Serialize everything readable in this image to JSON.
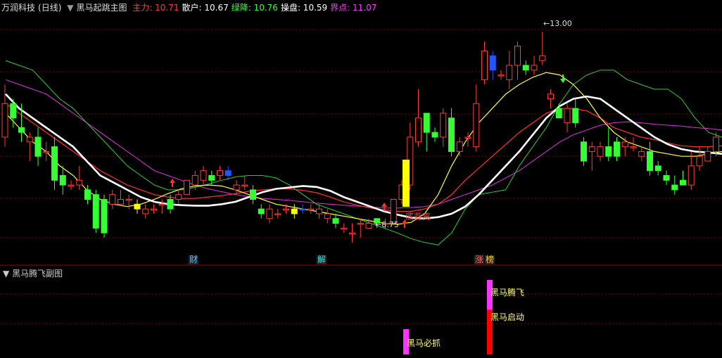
{
  "header": {
    "stock_name": "万润科技",
    "period": "(日线)",
    "indicator_name": "黑马起跳主图",
    "items": [
      {
        "label": "主力:",
        "value": "10.71",
        "color": "#ff3b3b"
      },
      {
        "label": "散户:",
        "value": "10.67",
        "color": "#ffffff"
      },
      {
        "label": "绿降:",
        "value": "10.76",
        "color": "#33ff33"
      },
      {
        "label": "操盘:",
        "value": "10.59",
        "color": "#ffffff"
      },
      {
        "label": "界点:",
        "value": "11.07",
        "color": "#ff33ff"
      }
    ]
  },
  "sub_panel": {
    "title": "黑马腾飞副图"
  },
  "markers": {
    "events": [
      "财",
      "解",
      "涨",
      "榜"
    ]
  },
  "chart_data": {
    "type": "candlestick",
    "price_range": [
      8.2,
      13.4
    ],
    "annotations": {
      "high_label": "13.00",
      "low_label": "8.75",
      "signal_text": "底背离"
    },
    "candles": [
      [
        10.8,
        11.5,
        11.9,
        10.6
      ],
      [
        11.5,
        11.2,
        11.6,
        11.0
      ],
      [
        11.0,
        10.9,
        11.5,
        10.7
      ],
      [
        10.7,
        10.8,
        10.9,
        10.3
      ],
      [
        10.8,
        10.4,
        11.0,
        10.2
      ],
      [
        10.5,
        10.5,
        10.7,
        10.3
      ],
      [
        10.6,
        9.9,
        10.8,
        9.7
      ],
      [
        10.0,
        9.8,
        10.2,
        9.6
      ],
      [
        9.8,
        9.8,
        9.9,
        9.7
      ],
      [
        9.8,
        9.9,
        10.2,
        9.7
      ],
      [
        9.7,
        9.5,
        9.8,
        9.4
      ],
      [
        9.6,
        8.9,
        9.7,
        8.8
      ],
      [
        9.5,
        8.8,
        9.6,
        8.7
      ],
      [
        9.4,
        9.6,
        9.7,
        9.3
      ],
      [
        9.4,
        9.5,
        9.7,
        9.4
      ],
      [
        9.5,
        9.5,
        9.6,
        9.3
      ],
      [
        9.4,
        9.3,
        9.5,
        9.2
      ],
      [
        9.2,
        9.3,
        9.4,
        9.1
      ],
      [
        9.3,
        9.3,
        9.4,
        9.2
      ],
      [
        9.4,
        9.4,
        9.5,
        9.2
      ],
      [
        9.5,
        9.3,
        9.6,
        9.2
      ],
      [
        9.5,
        9.6,
        9.7,
        9.4
      ],
      [
        9.6,
        9.9,
        9.9,
        9.6
      ],
      [
        9.8,
        10.0,
        10.1,
        9.7
      ],
      [
        9.9,
        10.1,
        10.2,
        9.8
      ],
      [
        10.0,
        9.9,
        10.1,
        9.8
      ],
      [
        10.0,
        10.1,
        10.2,
        9.9
      ],
      [
        10.0,
        10.1,
        10.2,
        9.9
      ],
      [
        9.7,
        9.8,
        9.9,
        9.6
      ],
      [
        9.8,
        9.8,
        10.0,
        9.7
      ],
      [
        9.7,
        9.5,
        9.8,
        9.4
      ],
      [
        9.3,
        9.2,
        9.4,
        9.1
      ],
      [
        9.1,
        9.3,
        9.4,
        9.0
      ],
      [
        9.2,
        9.2,
        9.3,
        9.1
      ],
      [
        9.3,
        9.3,
        9.4,
        9.2
      ],
      [
        9.2,
        9.3,
        9.4,
        9.1
      ],
      [
        9.3,
        9.3,
        9.4,
        9.2
      ],
      [
        9.3,
        9.3,
        9.4,
        9.2
      ],
      [
        9.2,
        9.3,
        9.4,
        9.1
      ],
      [
        9.1,
        9.2,
        9.3,
        9.0
      ],
      [
        9.1,
        9.0,
        9.2,
        8.9
      ],
      [
        8.9,
        8.9,
        9.0,
        8.8
      ],
      [
        8.8,
        8.8,
        9.0,
        8.6
      ],
      [
        9.0,
        9.0,
        9.1,
        8.7
      ],
      [
        8.9,
        9.0,
        9.1,
        8.9
      ],
      [
        9.1,
        9.0,
        9.1,
        8.9
      ],
      [
        9.0,
        9.0,
        9.1,
        8.9
      ],
      [
        9.0,
        9.5,
        9.5,
        9.0
      ],
      [
        9.5,
        9.8,
        9.9,
        9.4
      ],
      [
        9.8,
        10.8,
        11.1,
        9.7
      ],
      [
        10.7,
        11.2,
        11.8,
        10.6
      ],
      [
        11.3,
        10.9,
        11.3,
        10.5
      ],
      [
        10.9,
        10.8,
        11.0,
        10.7
      ],
      [
        10.8,
        11.3,
        11.4,
        10.6
      ],
      [
        11.2,
        10.5,
        11.4,
        10.4
      ],
      [
        10.5,
        10.7,
        10.8,
        10.4
      ],
      [
        10.8,
        10.8,
        10.9,
        10.6
      ],
      [
        10.6,
        11.5,
        11.9,
        10.5
      ],
      [
        12.0,
        12.6,
        12.8,
        11.9
      ],
      [
        12.5,
        12.2,
        12.6,
        12.0
      ],
      [
        12.1,
        12.1,
        12.2,
        12.0
      ],
      [
        12.0,
        12.3,
        12.6,
        11.8
      ],
      [
        12.3,
        12.7,
        12.8,
        12.0
      ],
      [
        12.3,
        12.2,
        12.4,
        12.1
      ],
      [
        12.2,
        12.3,
        12.5,
        12.1
      ],
      [
        12.4,
        12.5,
        13.0,
        12.3
      ],
      [
        11.6,
        11.7,
        11.8,
        11.4
      ],
      [
        11.4,
        11.2,
        11.5,
        11.3
      ],
      [
        11.1,
        11.4,
        11.5,
        10.9
      ],
      [
        11.4,
        11.1,
        11.6,
        11.0
      ],
      [
        10.7,
        10.3,
        10.8,
        10.2
      ],
      [
        10.5,
        10.6,
        10.7,
        10.1
      ],
      [
        10.4,
        10.6,
        10.7,
        10.3
      ],
      [
        10.6,
        10.4,
        11.0,
        10.3
      ],
      [
        10.7,
        10.4,
        10.8,
        10.3
      ],
      [
        10.6,
        10.7,
        10.8,
        10.4
      ],
      [
        10.6,
        10.6,
        10.8,
        10.5
      ],
      [
        10.4,
        10.5,
        10.6,
        10.3
      ],
      [
        10.5,
        10.1,
        10.7,
        10.0
      ],
      [
        10.2,
        10.1,
        10.3,
        10.0
      ],
      [
        10.0,
        9.9,
        10.1,
        9.8
      ],
      [
        9.8,
        9.7,
        10.0,
        9.6
      ],
      [
        9.9,
        9.8,
        10.1,
        9.8
      ],
      [
        9.8,
        10.2,
        10.5,
        9.7
      ],
      [
        10.2,
        10.4,
        10.6,
        10.1
      ],
      [
        10.3,
        10.5,
        10.6,
        10.3
      ],
      [
        10.5,
        10.8,
        10.9,
        10.4
      ]
    ],
    "special_candles": {
      "yellow": [
        16,
        35
      ],
      "blue": [
        27,
        36,
        59
      ]
    },
    "lines": [
      {
        "name": "操盘",
        "color": "#ffffff",
        "width": 2.6,
        "values": [
          11.7,
          11.4,
          11.2,
          11.0,
          10.8,
          10.6,
          10.3,
          10.0,
          9.85,
          9.7,
          9.55,
          9.45,
          9.4,
          9.38,
          9.37,
          9.37,
          9.4,
          9.45,
          9.55,
          9.65,
          9.72,
          9.75,
          9.78,
          9.76,
          9.68,
          9.55,
          9.45,
          9.35,
          9.25,
          9.18,
          9.12,
          9.1,
          9.13,
          9.2,
          9.35,
          9.6,
          9.9,
          10.2,
          10.5,
          10.85,
          11.2,
          11.45,
          11.6,
          11.65,
          11.6,
          11.4,
          11.2,
          11.0,
          10.8,
          10.65,
          10.55,
          10.5,
          10.48,
          10.45
        ]
      },
      {
        "name": "主力",
        "color": "#ff3030",
        "width": 1.2,
        "values": [
          11.5,
          11.3,
          11.1,
          10.9,
          10.7,
          10.5,
          10.3,
          10.1,
          9.95,
          9.8,
          9.7,
          9.6,
          9.55,
          9.52,
          9.52,
          9.55,
          9.58,
          9.62,
          9.67,
          9.7,
          9.72,
          9.72,
          9.69,
          9.64,
          9.55,
          9.45,
          9.38,
          9.32,
          9.28,
          9.25,
          9.25,
          9.3,
          9.4,
          9.6,
          9.9,
          10.15,
          10.4,
          10.65,
          10.9,
          11.1,
          11.3,
          11.4,
          11.4,
          11.35,
          11.2,
          11.0,
          10.9,
          10.8,
          10.75,
          10.68,
          10.62,
          10.6,
          10.6,
          10.62
        ]
      },
      {
        "name": "散户",
        "color": "#ffff33",
        "width": 1.2,
        "values": [
          11.3,
          11.0,
          10.7,
          10.5,
          10.2,
          10.0,
          9.7,
          9.5,
          9.4,
          9.35,
          9.4,
          9.5,
          9.62,
          9.72,
          9.78,
          9.8,
          9.78,
          9.7,
          9.6,
          9.5,
          9.4,
          9.35,
          9.3,
          9.25,
          9.2,
          9.15,
          9.1,
          9.05,
          9.0,
          8.98,
          9.02,
          9.2,
          9.6,
          10.2,
          10.7,
          11.1,
          11.4,
          11.7,
          11.9,
          12.05,
          12.15,
          12.1,
          11.9,
          11.6,
          11.2,
          10.9,
          10.7,
          10.6,
          10.5,
          10.45,
          10.4,
          10.4,
          10.45,
          10.5
        ]
      },
      {
        "name": "绿降",
        "color": "#33cc33",
        "width": 1.0,
        "values": [
          12.4,
          12.3,
          12.2,
          11.9,
          11.6,
          11.4,
          11.1,
          10.8,
          10.5,
          10.2,
          10.0,
          9.8,
          9.7,
          9.7,
          9.75,
          9.82,
          9.9,
          9.97,
          10.0,
          10.0,
          9.95,
          9.8,
          9.6,
          9.4,
          9.3,
          9.2,
          9.1,
          9.0,
          8.9,
          8.8,
          8.68,
          8.6,
          8.55,
          8.8,
          9.3,
          9.6,
          9.65,
          9.7,
          10.2,
          10.6,
          11.0,
          11.5,
          11.9,
          12.1,
          12.2,
          12.2,
          12.0,
          11.9,
          11.8,
          11.8,
          11.6,
          11.2,
          10.9,
          10.8
        ]
      },
      {
        "name": "界点",
        "color": "#dd33dd",
        "width": 1.0,
        "values": [
          12.0,
          11.9,
          11.8,
          11.7,
          11.5,
          11.3,
          11.1,
          10.9,
          10.7,
          10.5,
          10.3,
          10.1,
          10.0,
          9.9,
          9.8,
          9.72,
          9.66,
          9.6,
          9.56,
          9.52,
          9.5,
          9.48,
          9.45,
          9.42,
          9.4,
          9.38,
          9.36,
          9.34,
          9.32,
          9.32,
          9.33,
          9.35,
          9.4,
          9.5,
          9.6,
          9.7,
          9.8,
          9.95,
          10.1,
          10.3,
          10.5,
          10.7,
          10.85,
          10.95,
          11.05,
          11.1,
          11.12,
          11.1,
          11.07,
          11.05,
          11.03,
          11.0,
          10.98,
          10.95
        ]
      }
    ],
    "sub_bars": [
      {
        "index": 35,
        "label": "黑马必抓",
        "segments": [
          {
            "from": 0,
            "to": 1,
            "color": "#ff33ff"
          }
        ]
      },
      {
        "index": 42,
        "label": "黑马腾飞",
        "segments": [
          {
            "from": 0,
            "to": 0.6,
            "color": "#ff0000"
          },
          {
            "from": 0.6,
            "to": 1,
            "color": "#ff33ff"
          }
        ]
      },
      {
        "index": 42,
        "label": "黑马启动",
        "segments": []
      }
    ]
  }
}
